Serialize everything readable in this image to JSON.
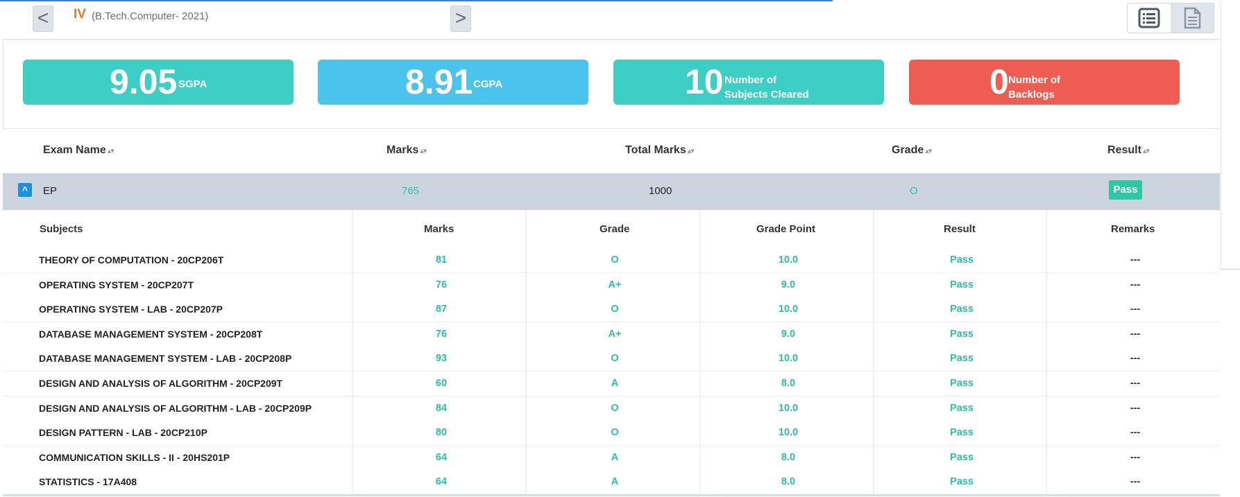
{
  "colors": {
    "teal": "#3ecfc4",
    "blue": "#4ac4ea",
    "red": "#ef5d52",
    "accent": "#2bbfa0",
    "orange": "#e8762b"
  },
  "nav": {
    "prev_icon": "chevron-left-icon",
    "prev_glyph": "<",
    "next_icon": "chevron-right-icon",
    "next_glyph": ">",
    "semester": "IV",
    "program": "(B.Tech.Computer- 2021)",
    "view_list_icon": "list-view-icon",
    "view_doc_icon": "document-view-icon"
  },
  "stats": [
    {
      "value": "9.05",
      "label": "SGPA"
    },
    {
      "value": "8.91",
      "label": "CGPA"
    },
    {
      "value": "10",
      "label_line1": "Number of",
      "label_line2": "Subjects Cleared"
    },
    {
      "value": "0",
      "label_line1": "Number of",
      "label_line2": "Backlogs"
    }
  ],
  "exam_table": {
    "headers": [
      "Exam Name",
      "Marks",
      "Total Marks",
      "Grade",
      "Result"
    ],
    "sort_glyph": "▴▾",
    "toggle_glyph": "^",
    "row": {
      "exam_name": "EP",
      "marks": "765",
      "total_marks": "1000",
      "grade": "O",
      "result": "Pass"
    }
  },
  "subject_table": {
    "headers": [
      "Subjects",
      "Marks",
      "Grade",
      "Grade Point",
      "Result",
      "Remarks"
    ],
    "rows": [
      {
        "subject": "THEORY OF COMPUTATION - 20CP206T",
        "marks": "81",
        "grade": "O",
        "grade_point": "10.0",
        "result": "Pass",
        "remarks": "---"
      },
      {
        "subject": "OPERATING SYSTEM - 20CP207T",
        "marks": "76",
        "grade": "A+",
        "grade_point": "9.0",
        "result": "Pass",
        "remarks": "---"
      },
      {
        "subject": "OPERATING SYSTEM - LAB - 20CP207P",
        "marks": "87",
        "grade": "O",
        "grade_point": "10.0",
        "result": "Pass",
        "remarks": "---"
      },
      {
        "subject": "DATABASE MANAGEMENT SYSTEM - 20CP208T",
        "marks": "76",
        "grade": "A+",
        "grade_point": "9.0",
        "result": "Pass",
        "remarks": "---"
      },
      {
        "subject": "DATABASE MANAGEMENT SYSTEM - LAB - 20CP208P",
        "marks": "93",
        "grade": "O",
        "grade_point": "10.0",
        "result": "Pass",
        "remarks": "---"
      },
      {
        "subject": "DESIGN AND ANALYSIS OF ALGORITHM - 20CP209T",
        "marks": "60",
        "grade": "A",
        "grade_point": "8.0",
        "result": "Pass",
        "remarks": "---"
      },
      {
        "subject": "DESIGN AND ANALYSIS OF ALGORITHM - LAB - 20CP209P",
        "marks": "84",
        "grade": "O",
        "grade_point": "10.0",
        "result": "Pass",
        "remarks": "---"
      },
      {
        "subject": "DESIGN PATTERN - LAB - 20CP210P",
        "marks": "80",
        "grade": "O",
        "grade_point": "10.0",
        "result": "Pass",
        "remarks": "---"
      },
      {
        "subject": "COMMUNICATION SKILLS - II - 20HS201P",
        "marks": "64",
        "grade": "A",
        "grade_point": "8.0",
        "result": "Pass",
        "remarks": "---"
      },
      {
        "subject": "STATISTICS - 17A408",
        "marks": "64",
        "grade": "A",
        "grade_point": "8.0",
        "result": "Pass",
        "remarks": "---"
      }
    ]
  }
}
